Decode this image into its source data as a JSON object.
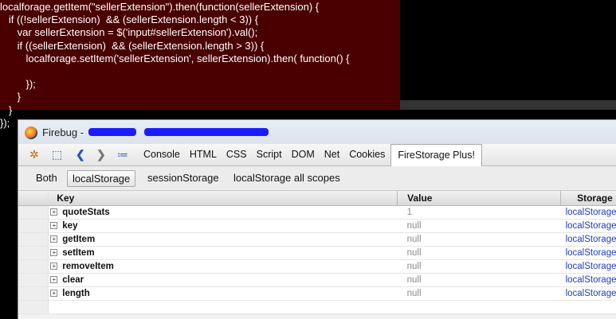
{
  "code": {
    "lines": [
      "localforage.getItem(\"sellerExtension\").then(function(sellerExtension) {",
      "   if ((!sellerExtension)  && (sellerExtension.length < 3)) {",
      "      var sellerExtension = $('input#sellerExtension').val();",
      "      if ((sellerExtension)  && (sellerExtension.length > 3)) {",
      "         localforage.setItem('sellerExtension', sellerExtension).then( function() {",
      "",
      "         });",
      "      }",
      "   }",
      "});"
    ]
  },
  "window": {
    "title": "Firebug - "
  },
  "toolbar": {
    "tabs": [
      "Console",
      "HTML",
      "CSS",
      "Script",
      "DOM",
      "Net",
      "Cookies",
      "FireStorage Plus!"
    ],
    "active_tab": "FireStorage Plus!"
  },
  "subtabs": [
    "Both",
    "localStorage",
    "sessionStorage",
    "localStorage all scopes"
  ],
  "table": {
    "headers": {
      "key": "Key",
      "value": "Value",
      "storage": "Storage"
    },
    "rows": [
      {
        "key": "quoteStats",
        "value": "1",
        "storage": "localStorage"
      },
      {
        "key": "key",
        "value": "null",
        "storage": "localStorage"
      },
      {
        "key": "getItem",
        "value": "null",
        "storage": "localStorage"
      },
      {
        "key": "setItem",
        "value": "null",
        "storage": "localStorage"
      },
      {
        "key": "removeItem",
        "value": "null",
        "storage": "localStorage"
      },
      {
        "key": "clear",
        "value": "null",
        "storage": "localStorage"
      },
      {
        "key": "length",
        "value": "null",
        "storage": "localStorage"
      }
    ]
  },
  "colors": {
    "code_bg": "#4a0000",
    "storage_link": "#1f3cc3",
    "redaction": "#1b1bff"
  }
}
